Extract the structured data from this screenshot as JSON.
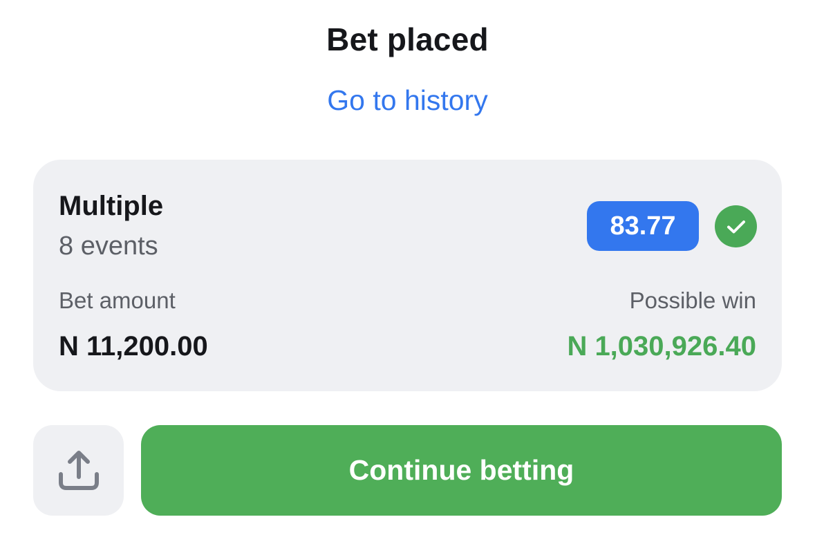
{
  "header": {
    "title": "Bet placed",
    "history_link": "Go to history"
  },
  "bet_card": {
    "type": "Multiple",
    "events": "8 events",
    "odds": "83.77",
    "status_icon": "check-icon",
    "bet_amount_label": "Bet amount",
    "bet_amount_value": "N 11,200.00",
    "possible_win_label": "Possible win",
    "possible_win_value": "N 1,030,926.40"
  },
  "actions": {
    "share_icon": "share-icon",
    "continue_label": "Continue betting"
  },
  "colors": {
    "accent_blue": "#3377ee",
    "success_green": "#4fae58",
    "win_green": "#4aa957",
    "card_background": "#eff0f3"
  }
}
